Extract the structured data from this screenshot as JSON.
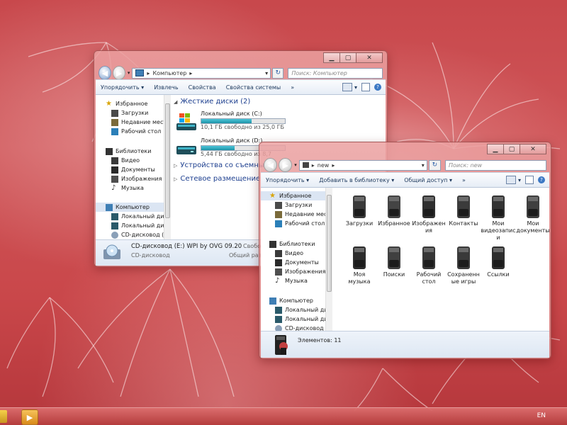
{
  "colors": {
    "accent": "#1d3f8f",
    "drive_fill": "#1e93a8",
    "desktop": "#c9474a"
  },
  "win1": {
    "address": "Компьютер",
    "search_placeholder": "Поиск: Компьютер",
    "toolbar": [
      "Упорядочить ▾",
      "Извлечь",
      "Свойства",
      "Свойства системы",
      "»"
    ],
    "nav": {
      "favorites": "Избранное",
      "fav_items": [
        "Загрузки",
        "Недавние места",
        "Рабочий стол"
      ],
      "libraries": "Библиотеки",
      "lib_items": [
        "Видео",
        "Документы",
        "Изображения",
        "Музыка"
      ],
      "computer": "Компьютер",
      "comp_items": [
        "Локальный диск",
        "Локальный диск",
        "CD-дисковод (E:)"
      ]
    },
    "groups": {
      "hdd": "Жесткие диски (2)",
      "removable": "Устройства со съемными",
      "network": "Сетевое размещение (2)"
    },
    "drives": [
      {
        "name": "Локальный диск (C:)",
        "free": "10,1 ГБ свободно из 25,0 ГБ",
        "used_fraction": 0.6
      },
      {
        "name": "Локальный диск (D:)",
        "free": "5,44 ГБ свободно из 8,7",
        "used_fraction": 0.4
      }
    ],
    "status": {
      "title": "CD-дисковод (E:) WPI by OVG 09.20",
      "type": "CD-дисковод",
      "r1": "Свобо",
      "r2": "Общий разм"
    }
  },
  "win2": {
    "address": "new",
    "search_placeholder": "Поиск: new",
    "toolbar": [
      "Упорядочить ▾",
      "Добавить в библиотеку ▾",
      "Общий доступ ▾",
      "»"
    ],
    "nav": {
      "favorites": "Избранное",
      "fav_items": [
        "Загрузки",
        "Недавние места",
        "Рабочий стол"
      ],
      "libraries": "Библиотеки",
      "lib_items": [
        "Видео",
        "Документы",
        "Изображения",
        "Музыка"
      ],
      "computer": "Компьютер",
      "comp_items": [
        "Локальный диск",
        "Локальный диск",
        "CD-дисковод (E:"
      ]
    },
    "folders": [
      "Загрузки",
      "Избранное",
      "Изображения",
      "Контакты",
      "Мои видеозаписи",
      "Мои документы",
      "Моя музыка",
      "Поиски",
      "Рабочий стол",
      "Сохраненные игры",
      "Ссылки"
    ],
    "status": "Элементов: 11"
  },
  "taskbar": {
    "lang": "EN"
  }
}
